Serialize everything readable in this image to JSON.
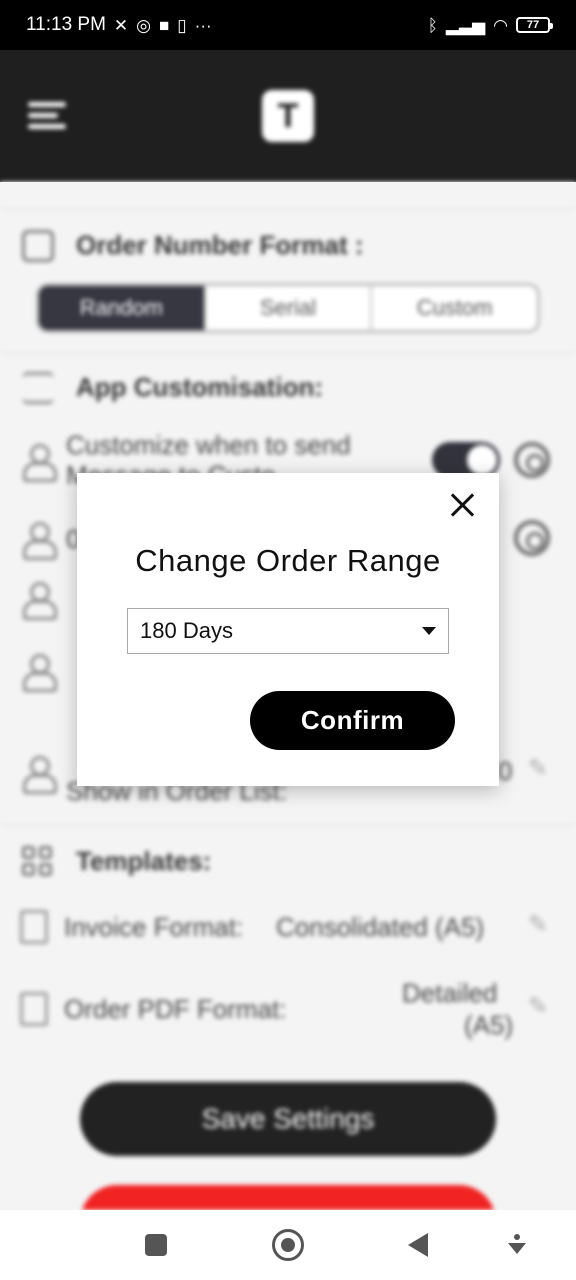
{
  "status_bar": {
    "time": "11:13 PM",
    "left_icons": [
      "mute-icon",
      "whatsapp-icon",
      "video-icon",
      "trash-icon",
      "more-icon"
    ],
    "right_icons": [
      "bluetooth-icon",
      "signal-icon",
      "wifi-icon"
    ],
    "battery": "77"
  },
  "header": {
    "logo_text": "T"
  },
  "settings": {
    "order_number_format": {
      "title": "Order Number Format :",
      "options": [
        "Random",
        "Serial",
        "Custom"
      ],
      "selected": "Random"
    },
    "app_customisation": {
      "title": "App Customisation:",
      "row1_label": "Customize when to send Message to Custo",
      "row1_toggle_on": true,
      "row2_trailing": "0",
      "row5_label_line2": "Show in Order List:",
      "row5_value": "0"
    },
    "templates": {
      "title": "Templates:",
      "invoice_label": "Invoice Format:",
      "invoice_value": "Consolidated (A5)",
      "order_pdf_label": "Order PDF Format:",
      "order_pdf_value_line1": "Detailed",
      "order_pdf_value_line2": "(A5)"
    },
    "save_button": "Save Settings"
  },
  "dialog": {
    "title": "Change Order Range",
    "select_value": "180 Days",
    "confirm_label": "Confirm"
  },
  "colors": {
    "header_bg": "#1b1b1b",
    "confirm_bg": "#000000",
    "danger": "#f11f1f",
    "segment_active": "#33333f"
  }
}
